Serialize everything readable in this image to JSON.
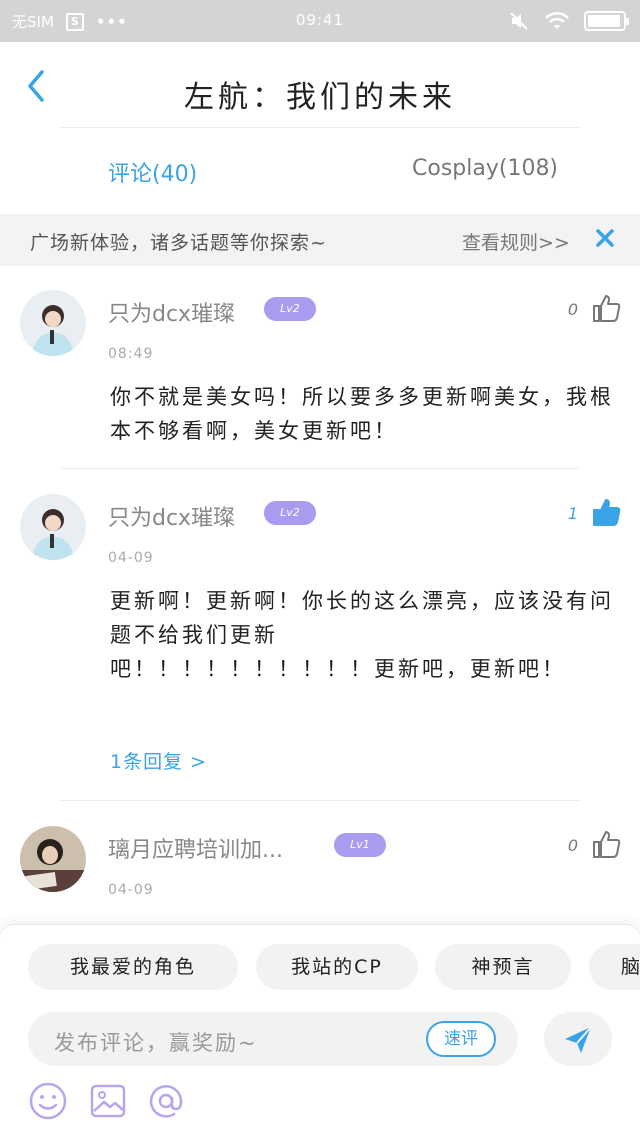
{
  "status_bar": {
    "carrier": "无SIM",
    "sim_icon_label": "S",
    "dots": "•••",
    "time": "09:41",
    "battery_level": 0.95,
    "icons": [
      "sim-card-icon",
      "more-dots-icon",
      "mute-icon",
      "wifi-icon",
      "battery-icon"
    ]
  },
  "header": {
    "title": "左航：我们的未来"
  },
  "tabs": [
    {
      "label": "评论(40)",
      "active": true
    },
    {
      "label": "Cosplay(108)",
      "active": false
    }
  ],
  "notice": {
    "text": "广场新体验，诸多话题等你探索~",
    "link": "查看规则>>"
  },
  "comments": [
    {
      "username": "只为dcx璀璨",
      "level": "Lv2",
      "likes": "0",
      "liked": false,
      "time": "08:49",
      "text": "你不就是美女吗！所以要多多更新啊美女，我根本不够看啊，美女更新吧！"
    },
    {
      "username": "只为dcx璀璨",
      "level": "Lv2",
      "likes": "1",
      "liked": true,
      "time": "04-09",
      "text": "更新啊！更新啊！你长的这么漂亮，应该没有问题不给我们更新\n吧！！！！！！！！！！更新吧，更新吧！",
      "replies": "1条回复 >"
    },
    {
      "username": "璃月应聘培训加...",
      "level": "Lv1",
      "likes": "0",
      "liked": false,
      "time": "04-09"
    }
  ],
  "bottom": {
    "chips": [
      "我最爱的角色",
      "我站的CP",
      "神预言",
      "脑"
    ],
    "input_placeholder": "发布评论，赢奖励~",
    "quick_comment": "速评",
    "tools": [
      "emoji-icon",
      "image-icon",
      "mention-icon"
    ]
  },
  "colors": {
    "accent": "#3aa3e8",
    "level_badge": "#a99bef",
    "status_bar": "#d4d4d4"
  }
}
